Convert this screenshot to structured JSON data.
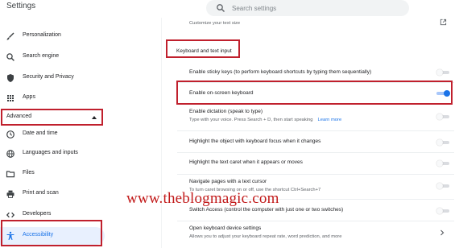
{
  "app": {
    "title": "Settings"
  },
  "search": {
    "placeholder": "Search settings",
    "value": ""
  },
  "sidebar": {
    "items": [
      {
        "label": "Personalization",
        "icon": "brush-icon"
      },
      {
        "label": "Search engine",
        "icon": "search-icon"
      },
      {
        "label": "Security and Privacy",
        "icon": "shield-icon"
      },
      {
        "label": "Apps",
        "icon": "apps-grid-icon"
      }
    ],
    "advanced_label": "Advanced",
    "advanced_items": [
      {
        "label": "Date and time",
        "icon": "clock-icon"
      },
      {
        "label": "Languages and inputs",
        "icon": "globe-icon"
      },
      {
        "label": "Files",
        "icon": "folder-icon"
      },
      {
        "label": "Print and scan",
        "icon": "printer-icon"
      },
      {
        "label": "Developers",
        "icon": "code-icon"
      },
      {
        "label": "Accessibility",
        "icon": "accessibility-icon",
        "active": true
      }
    ]
  },
  "main": {
    "top_partial_sub": "Customize your text size",
    "section_heading": "Keyboard and text input",
    "rows": [
      {
        "title": "Enable sticky keys (to perform keyboard shortcuts by typing them sequentially)",
        "toggle": "off"
      },
      {
        "title": "Enable on-screen keyboard",
        "toggle": "on"
      },
      {
        "title": "Enable dictation (speak to type)",
        "sub": "Type with your voice. Press Search + D, then start speaking",
        "link": "Learn more",
        "toggle": "off"
      },
      {
        "title": "Highlight the object with keyboard focus when it changes",
        "toggle": "off"
      },
      {
        "title": "Highlight the text caret when it appears or moves",
        "toggle": "off"
      },
      {
        "title": "Navigate pages with a text cursor",
        "sub": "To turn caret browsing on or off, use the shortcut Ctrl+Search+7",
        "toggle": "off"
      },
      {
        "title": "Switch Access (control the computer with just one or two switches)",
        "toggle": "off"
      },
      {
        "title": "Open keyboard device settings",
        "sub": "Allows you to adjust your keyboard repeat rate, word prediction, and more"
      }
    ]
  },
  "watermark": "www.theblogmagic.com",
  "colors": {
    "accent": "#1a73e8",
    "highlight_box": "#c0202d",
    "watermark": "#c21a1a"
  }
}
